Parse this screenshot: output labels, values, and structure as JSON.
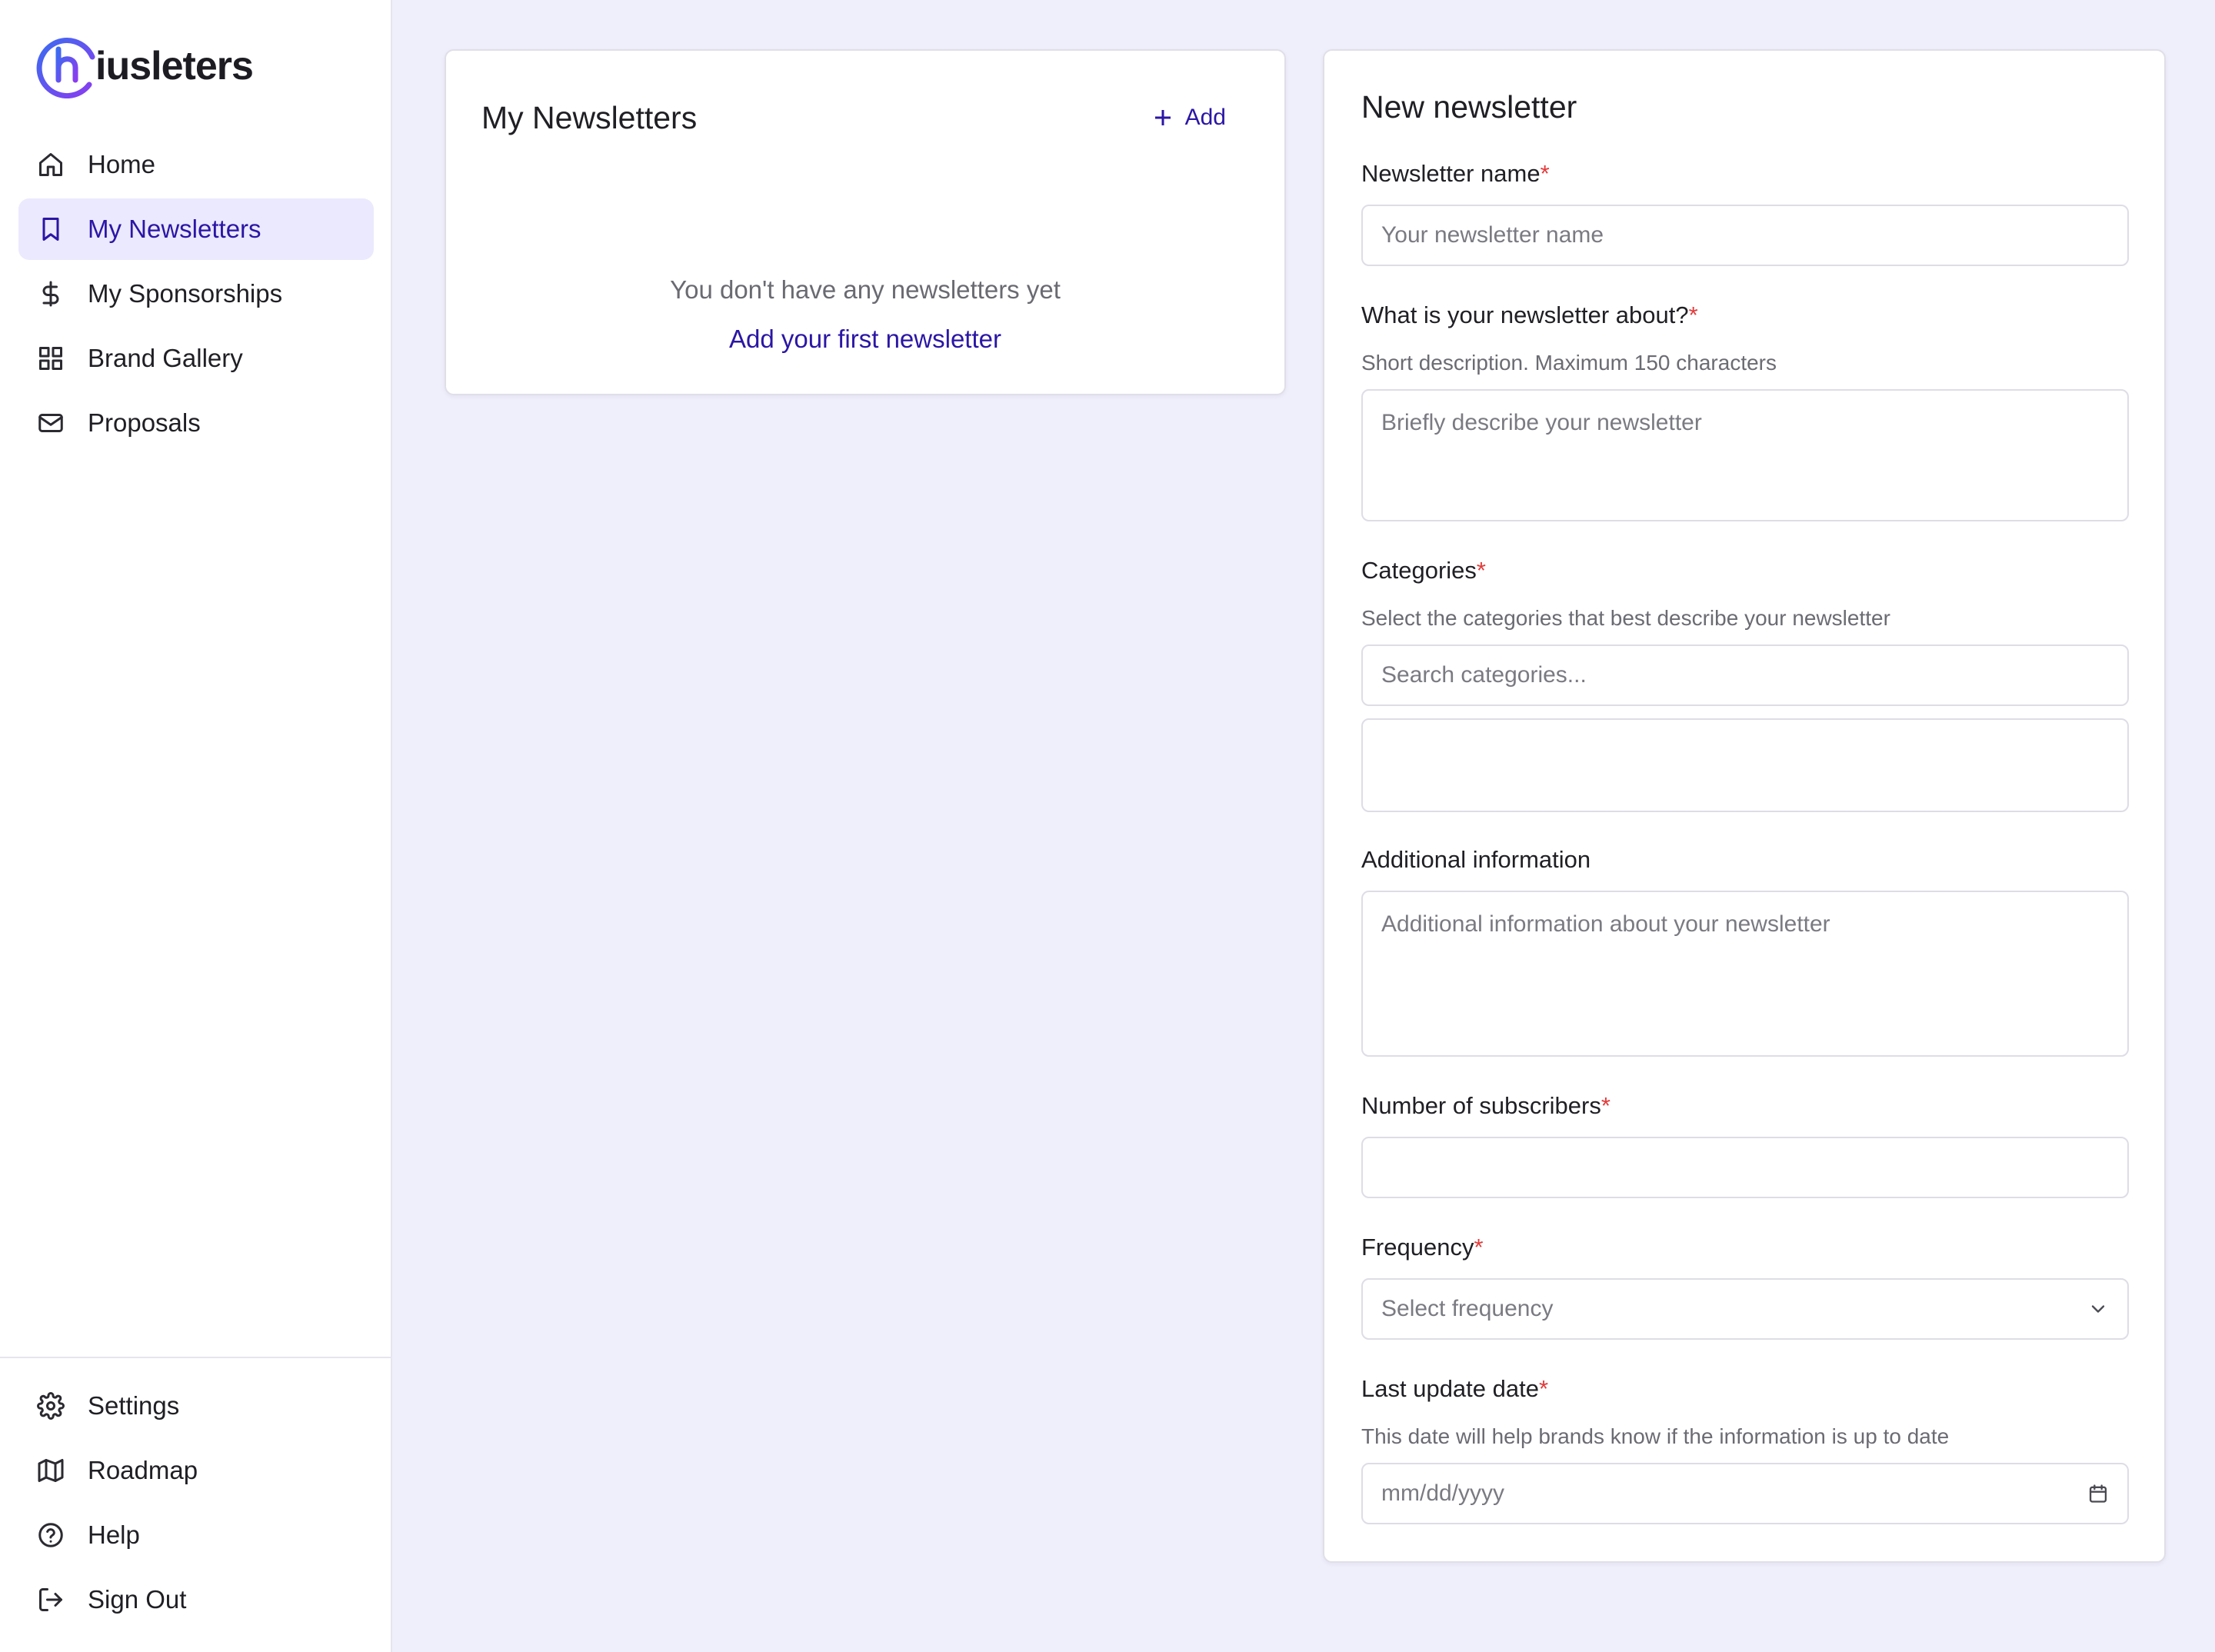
{
  "app": {
    "brand": "iusleters",
    "accent_color": "#2b16a5",
    "background_color": "#efeefb"
  },
  "sidebar": {
    "items": [
      {
        "label": "Home",
        "icon": "home-icon"
      },
      {
        "label": "My Newsletters",
        "icon": "bookmark-icon",
        "active": true
      },
      {
        "label": "My Sponsorships",
        "icon": "dollar-icon"
      },
      {
        "label": "Brand Gallery",
        "icon": "grid-icon"
      },
      {
        "label": "Proposals",
        "icon": "mail-icon"
      }
    ],
    "bottom_items": [
      {
        "label": "Settings",
        "icon": "gear-icon"
      },
      {
        "label": "Roadmap",
        "icon": "map-icon"
      },
      {
        "label": "Help",
        "icon": "help-circle-icon"
      },
      {
        "label": "Sign Out",
        "icon": "sign-out-icon"
      }
    ]
  },
  "newsletters_panel": {
    "title": "My Newsletters",
    "add_label": "Add",
    "empty_text": "You don't have any newsletters yet",
    "empty_link": "Add your first newsletter"
  },
  "form": {
    "title": "New newsletter",
    "required_mark": "*",
    "name": {
      "label": "Newsletter name",
      "placeholder": "Your newsletter name",
      "value": ""
    },
    "about": {
      "label": "What is your newsletter about?",
      "hint": "Short description. Maximum 150 characters",
      "placeholder": "Briefly describe your newsletter",
      "value": ""
    },
    "categories": {
      "label": "Categories",
      "hint": "Select the categories that best describe your newsletter",
      "search_placeholder": "Search categories..."
    },
    "additional": {
      "label": "Additional information",
      "placeholder": "Additional information about your newsletter",
      "value": ""
    },
    "subscribers": {
      "label": "Number of subscribers",
      "value": ""
    },
    "frequency": {
      "label": "Frequency",
      "selected": "Select frequency"
    },
    "last_update": {
      "label": "Last update date",
      "hint": "This date will help brands know if the information is up to date",
      "placeholder": "mm/dd/yyyy"
    }
  }
}
